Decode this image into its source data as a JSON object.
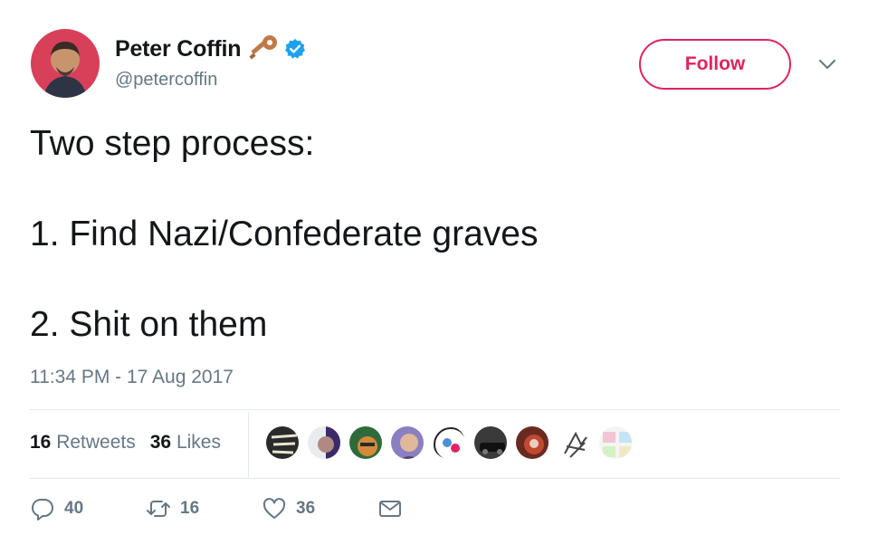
{
  "author": {
    "display_name": "Peter Coffin",
    "handle": "@petercoffin",
    "verified": true,
    "name_emoji": "key-icon"
  },
  "follow_button": {
    "label": "Follow"
  },
  "tweet": {
    "lines": [
      "Two step process:",
      "1. Find Nazi/Confederate graves",
      "2. Shit on them"
    ],
    "timestamp": "11:34 PM - 17 Aug 2017"
  },
  "stats": {
    "retweets_count": "16",
    "retweets_label": "Retweets",
    "likes_count": "36",
    "likes_label": "Likes"
  },
  "actions": {
    "reply_count": "40",
    "retweet_count": "16",
    "like_count": "36"
  },
  "colors": {
    "accent": "#e0245e",
    "verified": "#1da1f2",
    "muted": "#657786",
    "text": "#14171a"
  }
}
